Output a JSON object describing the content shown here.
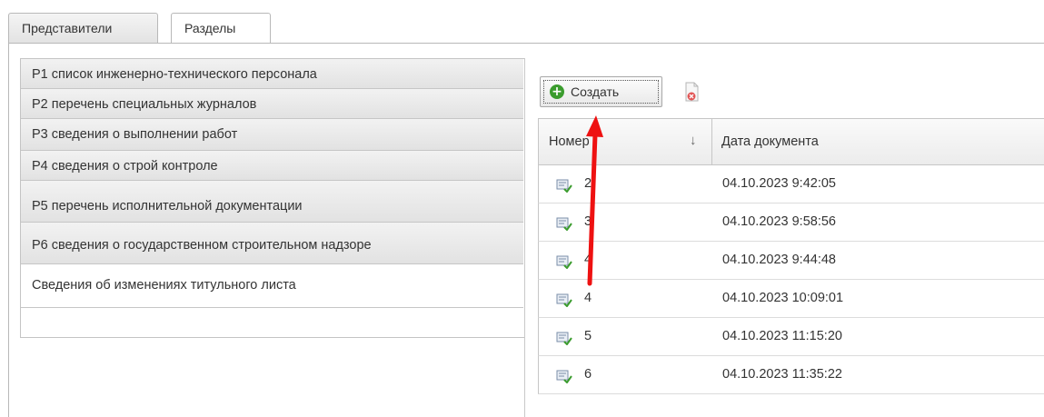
{
  "tabs": [
    {
      "label": "Представители",
      "active": false
    },
    {
      "label": "Разделы",
      "active": true
    }
  ],
  "sections": [
    {
      "label": "Р1 список инженерно-технического персонала"
    },
    {
      "label": "Р2 перечень специальных журналов"
    },
    {
      "label": "Р3 сведения о выполнении работ"
    },
    {
      "label": "Р4 сведения о строй контроле"
    },
    {
      "label": "Р5 перечень исполнительной документации"
    },
    {
      "label": "Р6 сведения о государственном строительном надзоре"
    },
    {
      "label": "Сведения об изменениях титульного листа",
      "selected": true
    }
  ],
  "toolbar": {
    "create_label": "Создать",
    "create_icon": "plus-circle-icon",
    "delete_icon": "delete-document-icon"
  },
  "grid": {
    "columns": [
      "Номер",
      "Дата документа"
    ],
    "sort_indicator": "↓",
    "rows": [
      {
        "number": "2",
        "date": "04.10.2023 9:42:05"
      },
      {
        "number": "3",
        "date": "04.10.2023 9:58:56"
      },
      {
        "number": "4",
        "date": "04.10.2023 9:44:48"
      },
      {
        "number": "4",
        "date": "04.10.2023 10:09:01"
      },
      {
        "number": "5",
        "date": "04.10.2023 11:15:20"
      },
      {
        "number": "6",
        "date": "04.10.2023 11:35:22"
      }
    ],
    "row_icon": "edit-document-icon"
  },
  "colors": {
    "annotation_arrow": "#ee1111",
    "create_icon": "#3b9c2e"
  }
}
